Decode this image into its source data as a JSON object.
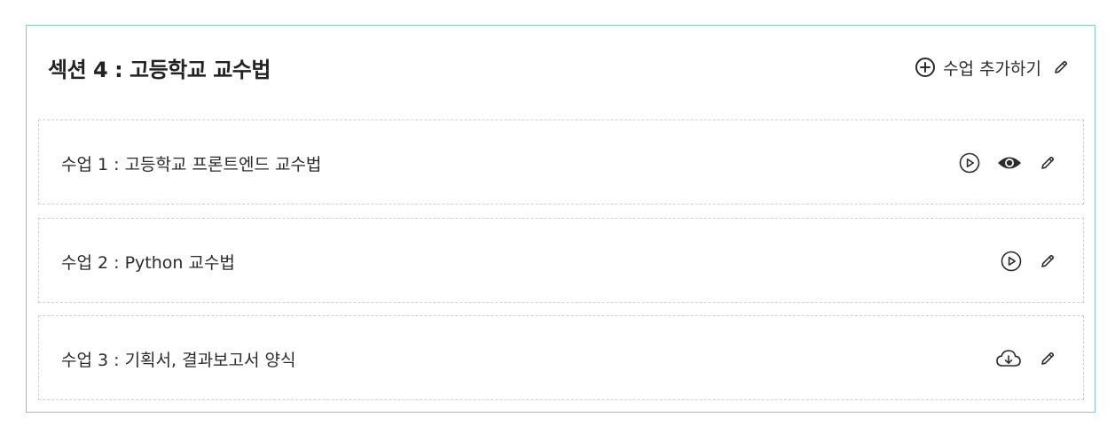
{
  "section": {
    "title": "섹션 4 : 고등학교 교수법",
    "add_lesson_label": "수업 추가하기",
    "accent_border_color": "#7fd3b4"
  },
  "lessons": [
    {
      "title": "수업 1 : 고등학교 프론트엔드 교수법",
      "icons": [
        "play-icon",
        "eye-icon",
        "pencil-icon"
      ]
    },
    {
      "title": "수업 2 : Python 교수법",
      "icons": [
        "play-icon",
        "pencil-icon"
      ]
    },
    {
      "title": "수업 3 : 기획서, 결과보고서 양식",
      "icons": [
        "cloud-download-icon",
        "pencil-icon"
      ]
    }
  ]
}
